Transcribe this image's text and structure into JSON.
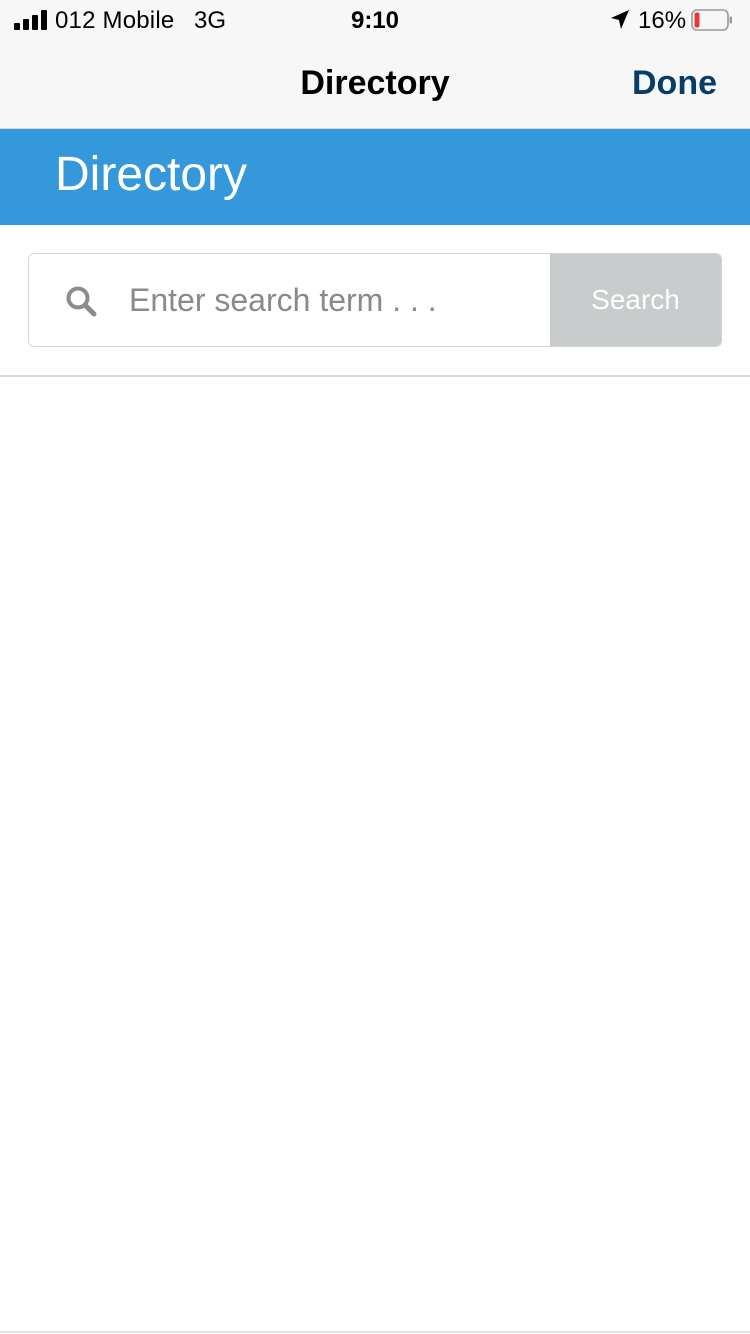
{
  "status_bar": {
    "carrier": "012 Mobile",
    "network": "3G",
    "time": "9:10",
    "battery_percent": "16%",
    "battery_level": 0.16,
    "icons": {
      "signal": "cellular-signal-icon",
      "location": "location-arrow-icon",
      "battery": "battery-low-icon"
    }
  },
  "nav_bar": {
    "title": "Directory",
    "done_label": "Done"
  },
  "header": {
    "title": "Directory"
  },
  "search": {
    "placeholder": "Enter search term . . .",
    "value": "",
    "button_label": "Search",
    "icon": "search-icon"
  },
  "colors": {
    "accent_blue": "#3498db",
    "done_text": "#0a3d66",
    "search_button_bg": "#c8cccd",
    "battery_low": "#e53935"
  }
}
